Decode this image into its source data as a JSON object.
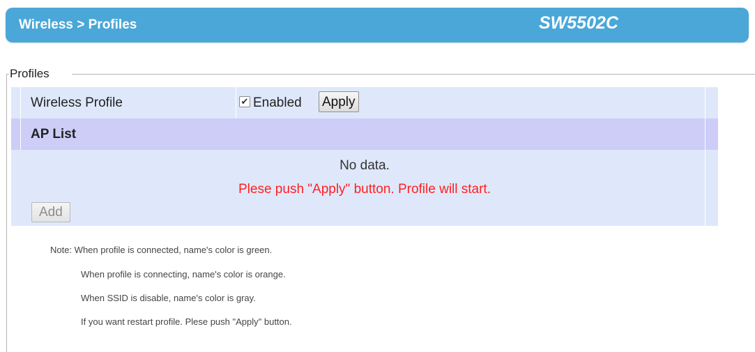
{
  "header": {
    "breadcrumb": "Wireless > Profiles",
    "model": "SW5502C",
    "bg_color": "#4aa7d8"
  },
  "fieldset": {
    "legend": "Profiles"
  },
  "wireless_profile": {
    "label": "Wireless Profile",
    "checkbox_checked": true,
    "checkbox_label": "Enabled",
    "apply_label": "Apply"
  },
  "ap_list": {
    "title": "AP List",
    "empty_text": "No data.",
    "message": "Plese push \"Apply\" button. Profile will start.",
    "message_color": "#ff2020",
    "add_label": "Add"
  },
  "notes": [
    "Note: When profile is connected, name's color is green.",
    "When profile is connecting, name's color is orange.",
    "When SSID is disable, name's color is gray.",
    "If you want restart profile. Plese push \"Apply\" button."
  ],
  "colors": {
    "row_light": "#dfe8fb",
    "row_header": "#cdcdf8"
  }
}
